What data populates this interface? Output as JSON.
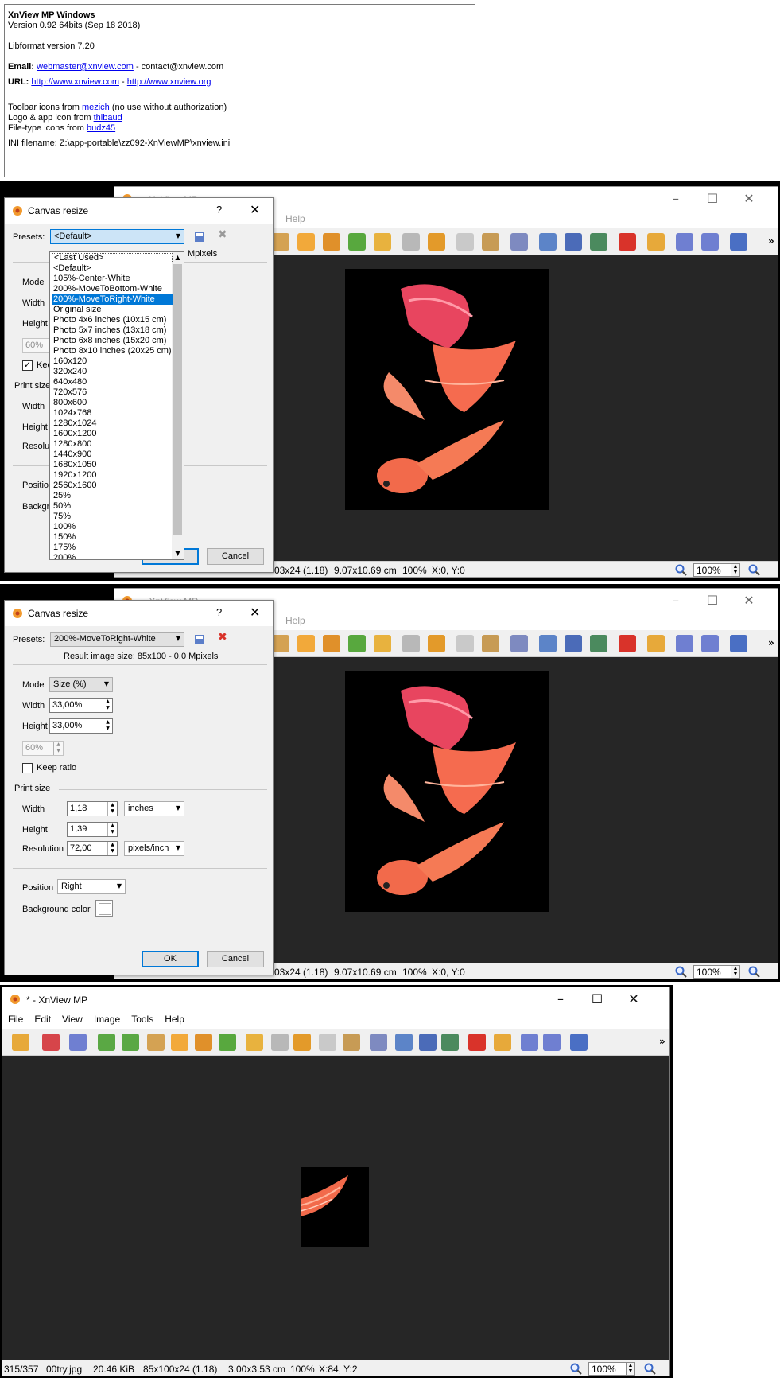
{
  "about": {
    "app_name": "XnView MP Windows",
    "version": "Version 0.92 64bits (Sep 18 2018)",
    "libformat": "Libformat version 7.20",
    "email_label": "Email:",
    "email_link": "webmaster@xnview.com",
    "email_sep": " - contact@xnview.com",
    "url_label": "URL:",
    "url_link_1": "http://www.xnview.com",
    "url_sep": " - ",
    "url_link_2": "http://www.xnview.org",
    "toolbar_prefix": "Toolbar icons from ",
    "toolbar_link": "mezich",
    "toolbar_suffix": " (no use without authorization)",
    "logo_prefix": "Logo & app icon from ",
    "logo_link": "thibaud",
    "filetype_prefix": "File-type icons from ",
    "filetype_link": "budz45",
    "ini": "INI filename: Z:\\app-portable\\zz092-XnViewMP\\xnview.ini"
  },
  "viewer": {
    "title_bg": "- XnView MP",
    "title_modified": "*  - XnView MP",
    "menu": [
      "File",
      "Edit",
      "View",
      "Image",
      "Tools",
      "Help"
    ],
    "menu_help_partial": "Help",
    "status_bg": [
      "03x24 (1.18)",
      "9.07x10.69 cm",
      "100%",
      "X:0, Y:0"
    ],
    "status_final": [
      "315/357",
      "00try.jpg",
      "20.46 KiB",
      "85x100x24 (1.18)",
      "3.00x3.53 cm",
      "100%",
      "X:84, Y:2"
    ],
    "zoom_value": "100%",
    "toolbar_more": "»"
  },
  "dialog": {
    "title": "Canvas resize",
    "help": "?",
    "presets_label": "Presets:",
    "preset_default": "<Default>",
    "preset_selected": "200%-MoveToRight-White",
    "result_partial": "Mpixels",
    "result_text": "Result image size: 85x100 - 0.0 Mpixels",
    "mode_label": "Mode",
    "mode_value": "Size (%)",
    "width_label": "Width",
    "height_label": "Height",
    "width_value": "33,00%",
    "height_value": "33,00%",
    "quality_value": "60%",
    "keep_ratio": "Keep ratio",
    "print_size": "Print size",
    "print_width": "1,18",
    "print_height": "1,39",
    "resolution_label": "Resolution",
    "resolution_value": "72,00",
    "unit": "inches",
    "res_unit": "pixels/inch",
    "position_label": "Position",
    "position_value": "Right",
    "bg_color_label": "Background color",
    "ok": "OK",
    "cancel": "Cancel",
    "partial_labels": {
      "mode": "Mode",
      "width": "Width",
      "height": "Height",
      "quality": "60%",
      "keep": "Kee",
      "print": "Print size",
      "p_width": "Width",
      "p_height": "Height",
      "resolu": "Resolu",
      "positi": "Positio",
      "backgr": "Backgro",
      "ok": "OK"
    }
  },
  "preset_options": [
    "<Last Used>",
    "<Default>",
    "105%-Center-White",
    "200%-MoveToBottom-White",
    "200%-MoveToRight-White",
    "Original size",
    "Photo 4x6 inches (10x15 cm)",
    "Photo 5x7 inches (13x18 cm)",
    "Photo 6x8 inches (15x20 cm)",
    "Photo 8x10 inches (20x25 cm)",
    "160x120",
    "320x240",
    "640x480",
    "720x576",
    "800x600",
    "1024x768",
    "1280x1024",
    "1600x1200",
    "1280x800",
    "1440x900",
    "1680x1050",
    "1920x1200",
    "2560x1600",
    "25%",
    "50%",
    "75%",
    "100%",
    "150%",
    "175%",
    "200%"
  ],
  "colors": {
    "canvas": "#262626",
    "accent": "#0078d7",
    "fish": "#f26a4b",
    "fin": "#e8455f"
  }
}
